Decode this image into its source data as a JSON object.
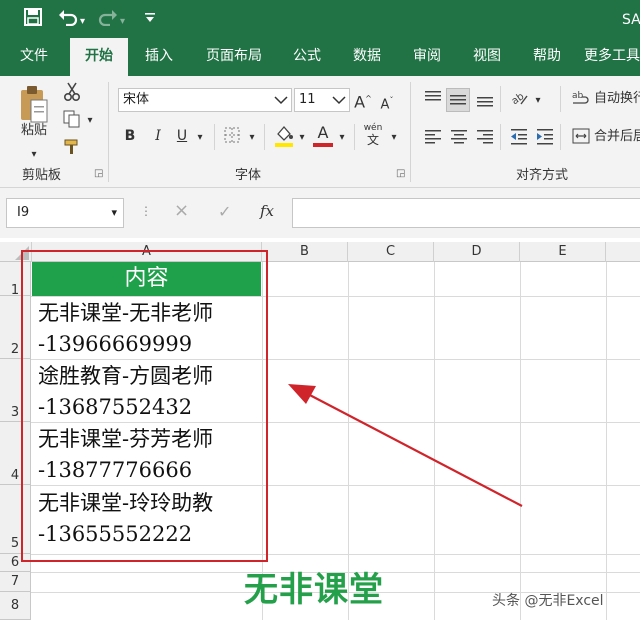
{
  "app": {
    "title_fragment": "SA"
  },
  "qat": {
    "save_icon": "save-icon",
    "undo_icon": "undo-icon",
    "redo_icon": "redo-icon",
    "customize_icon": "customize-qat-icon"
  },
  "menu_tabs": [
    "文件",
    "开始",
    "插入",
    "页面布局",
    "公式",
    "数据",
    "审阅",
    "视图",
    "帮助",
    "更多工具"
  ],
  "active_tab": "开始",
  "ribbon": {
    "clipboard": {
      "paste_label": "粘贴",
      "group_label": "剪贴板"
    },
    "font": {
      "font_name": "宋体",
      "font_size": "11",
      "bold": "B",
      "italic": "I",
      "underline": "U",
      "grow": "A",
      "shrink": "A",
      "font_color_letter": "A",
      "wen_top": "wén",
      "wen_bottom": "文",
      "group_label": "字体"
    },
    "alignment": {
      "wrap_label": "自动换行",
      "merge_label": "合并后居",
      "group_label": "对齐方式"
    }
  },
  "formula_bar": {
    "name_box": "I9",
    "cancel": "×",
    "enter": "✓",
    "fx": "fx"
  },
  "columns": [
    "A",
    "B",
    "C",
    "D",
    "E"
  ],
  "rows": [
    "1",
    "2",
    "3",
    "4",
    "5",
    "6",
    "7",
    "8"
  ],
  "cells": {
    "A1": "内容",
    "A2": [
      "无非课堂-无非老师",
      "-13966669999"
    ],
    "A3": [
      "途胜教育-方圆老师",
      "-13687552432"
    ],
    "A4": [
      "无非课堂-芬芳老师",
      "-13877776666"
    ],
    "A5": [
      "无非课堂-玲玲助教",
      "-13655552222"
    ]
  },
  "colors": {
    "excel_green": "#217346",
    "header_fill": "#1fa04a",
    "highlight_red": "#d0242b"
  },
  "watermark": "无非课堂",
  "credit": "头条 @无非Excel"
}
